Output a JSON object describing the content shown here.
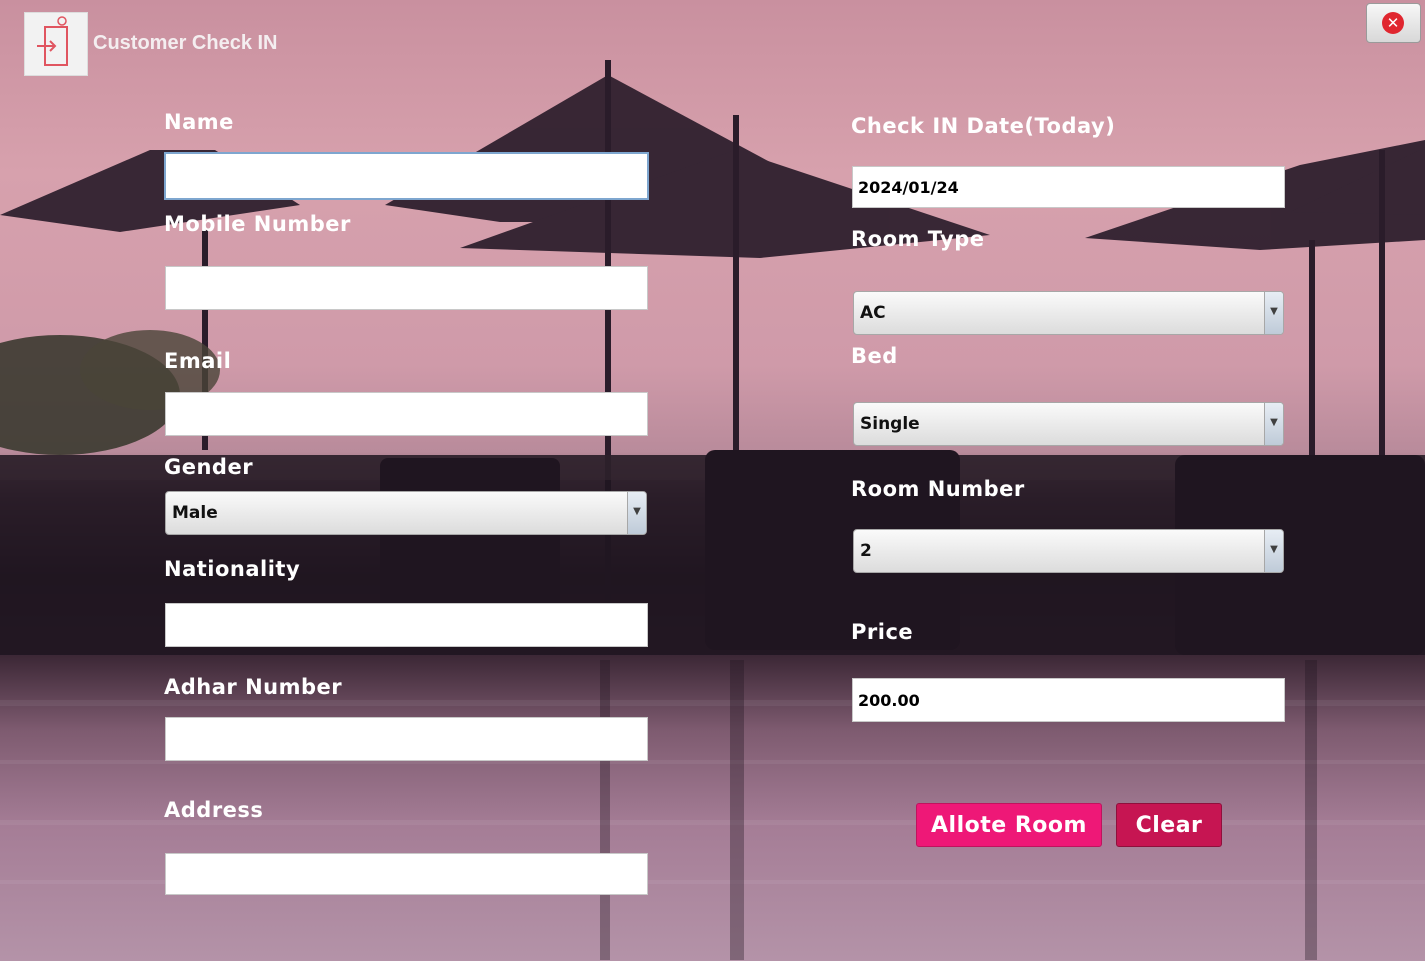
{
  "window": {
    "title": "Customer Check IN",
    "close_icon": "close-icon"
  },
  "form_left": {
    "name": {
      "label": "Name",
      "value": ""
    },
    "mobile": {
      "label": "Mobile Number",
      "value": ""
    },
    "email": {
      "label": "Email",
      "value": ""
    },
    "gender": {
      "label": "Gender",
      "selected": "Male"
    },
    "nationality": {
      "label": "Nationality",
      "value": ""
    },
    "adhar": {
      "label": "Adhar Number",
      "value": ""
    },
    "address": {
      "label": "Address",
      "value": ""
    }
  },
  "form_right": {
    "checkin_date": {
      "label": "Check IN Date(Today)",
      "value": "2024/01/24"
    },
    "room_type": {
      "label": "Room Type",
      "selected": "AC"
    },
    "bed": {
      "label": "Bed",
      "selected": "Single"
    },
    "room_number": {
      "label": "Room Number",
      "selected": "2"
    },
    "price": {
      "label": "Price",
      "value": "200.00"
    }
  },
  "buttons": {
    "allot": "Allote Room",
    "clear": "Clear"
  },
  "colors": {
    "accent": "#ee1877",
    "clear_button": "#c61552",
    "close": "#e0262f"
  }
}
